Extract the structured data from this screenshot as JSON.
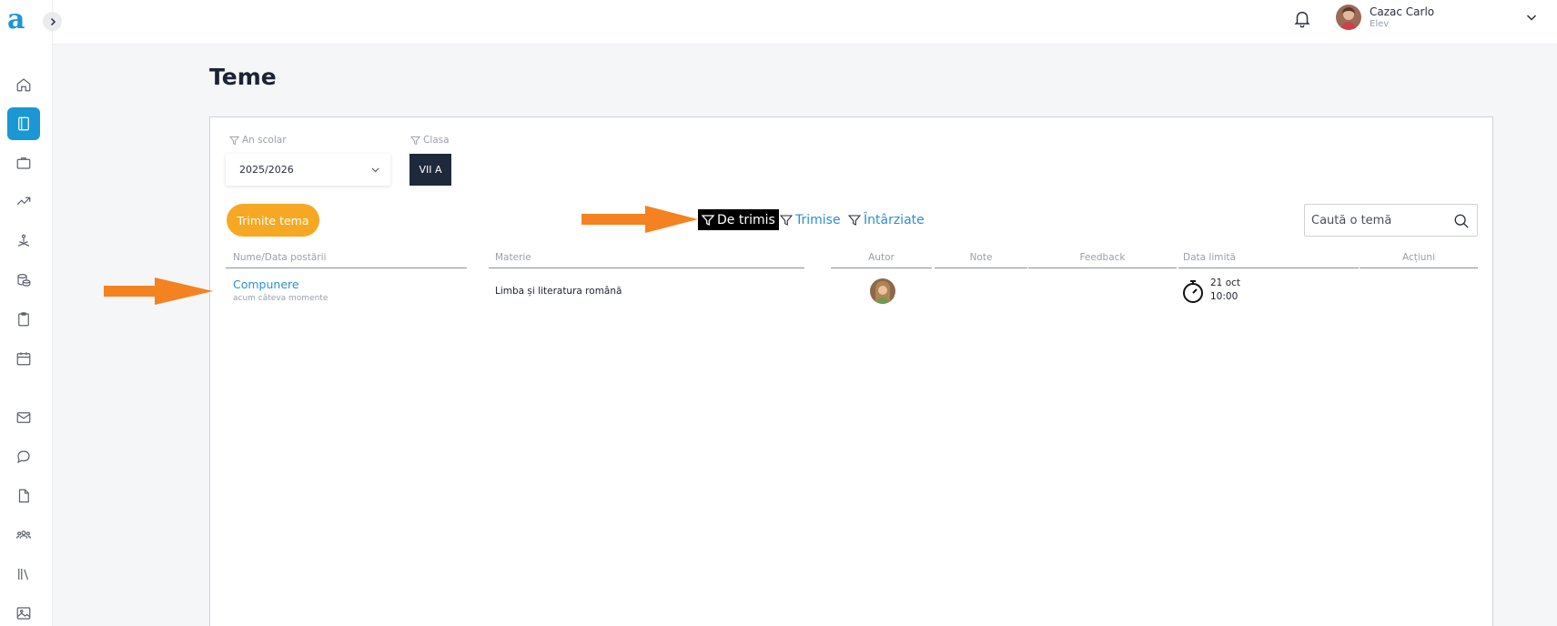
{
  "app": {
    "logo_letter": "a",
    "accent": "#1b97d4"
  },
  "sidebar": {
    "items": [
      {
        "name": "home",
        "icon": "home-icon"
      },
      {
        "name": "homework",
        "icon": "book-icon",
        "active": true
      },
      {
        "name": "portfolio",
        "icon": "briefcase-icon"
      },
      {
        "name": "progress",
        "icon": "trending-up-icon"
      },
      {
        "name": "activities",
        "icon": "meditation-icon"
      },
      {
        "name": "data",
        "icon": "database-icon"
      },
      {
        "name": "tests",
        "icon": "clipboard-icon"
      },
      {
        "name": "calendar",
        "icon": "calendar-icon"
      },
      {
        "name": "mail",
        "icon": "mail-icon"
      },
      {
        "name": "chat",
        "icon": "chat-icon"
      },
      {
        "name": "documents",
        "icon": "file-icon"
      },
      {
        "name": "groups",
        "icon": "users-icon"
      },
      {
        "name": "library",
        "icon": "library-icon"
      },
      {
        "name": "gallery",
        "icon": "image-icon"
      }
    ]
  },
  "header": {
    "user_name": "Cazac Carlo",
    "user_role": "Elev"
  },
  "page": {
    "title": "Teme"
  },
  "filters": {
    "year_label": "An scolar",
    "year_value": "2025/2026",
    "class_label": "Clasa",
    "class_value": "VII A"
  },
  "actions": {
    "send_label": "Trimite tema"
  },
  "status_tabs": [
    {
      "label": "De trimis",
      "active": true
    },
    {
      "label": "Trimise",
      "active": false
    },
    {
      "label": "Întârziate",
      "active": false
    }
  ],
  "search": {
    "placeholder": "Caută o temă"
  },
  "table": {
    "headers": [
      "Nume/Data postării",
      "Materie",
      "Autor",
      "Note",
      "Feedback",
      "Data limită",
      "Acțiuni"
    ],
    "rows": [
      {
        "name": "Compunere",
        "posted": "acum câteva momente",
        "subject": "Limba și literatura română",
        "grade": "",
        "feedback": "",
        "deadline_date": "21 oct",
        "deadline_time": "10:00"
      }
    ]
  },
  "colors": {
    "send_button": "#f7a823",
    "annotation_arrow": "#f58220",
    "link": "#2c8fcf",
    "class_chip": "#1e2a3b"
  }
}
